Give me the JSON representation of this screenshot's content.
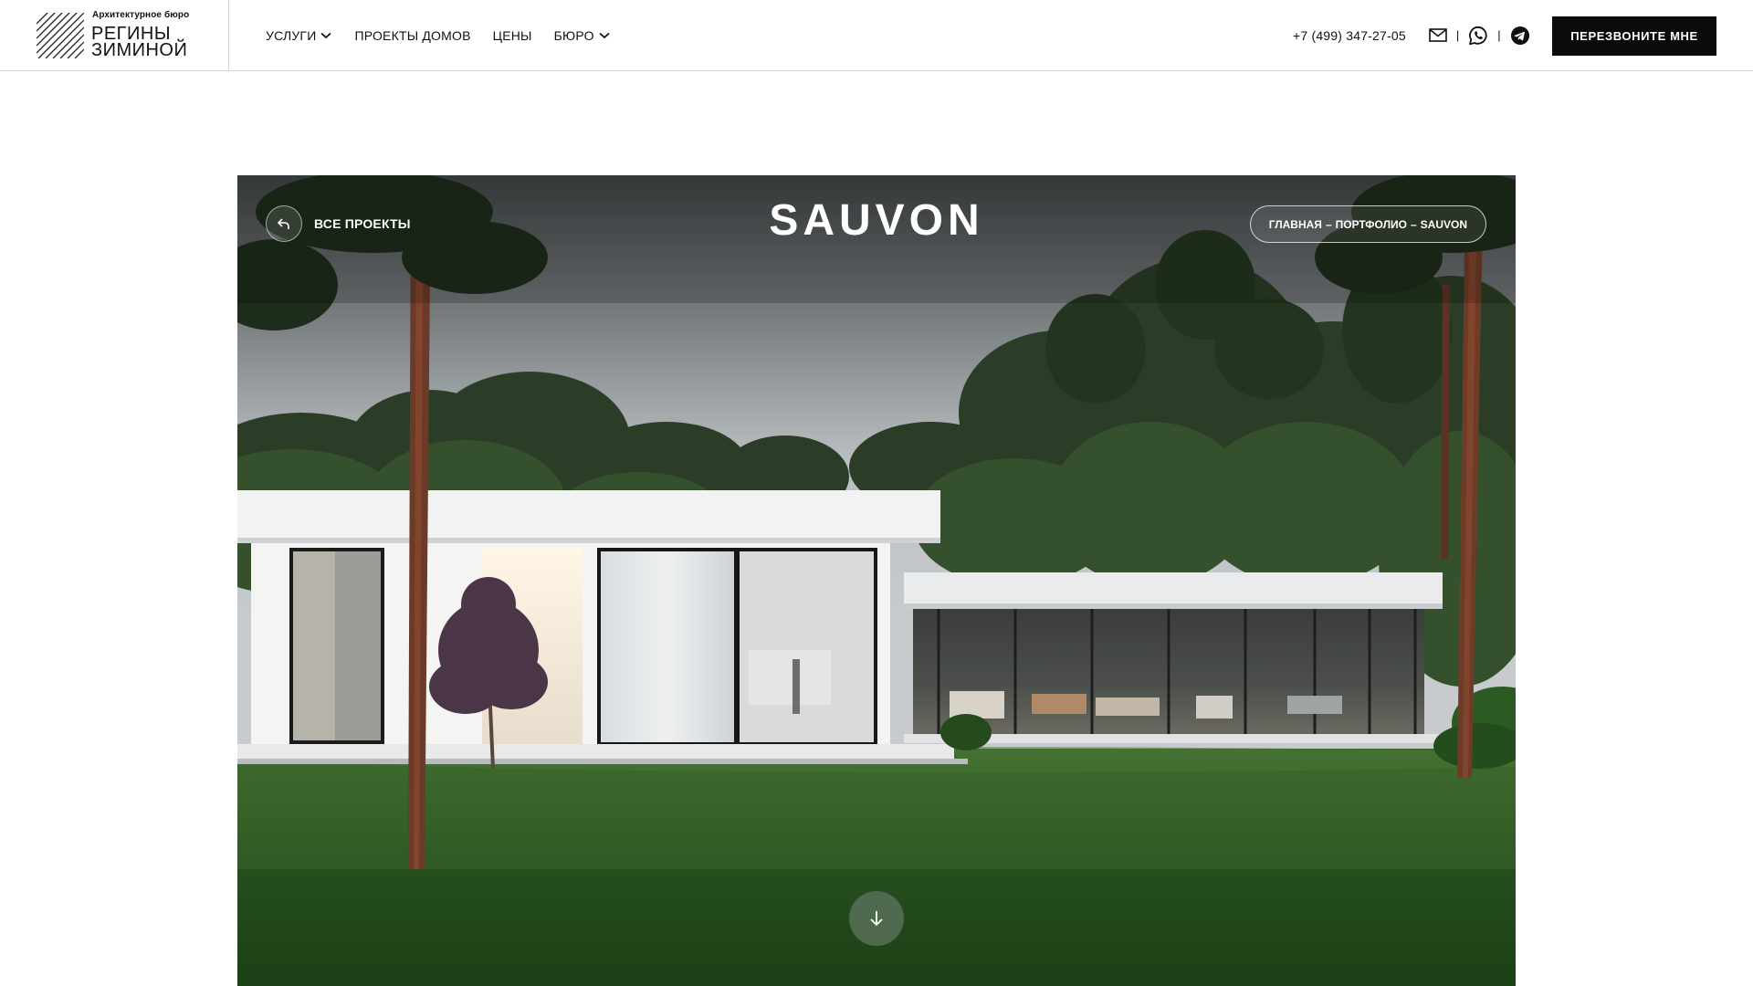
{
  "logo": {
    "subtitle": "Архитектурное бюро",
    "line1": "РЕГИНЫ",
    "line2": "ЗИМИНОЙ"
  },
  "nav": {
    "items": [
      {
        "label": "УСЛУГИ",
        "has_dropdown": true
      },
      {
        "label": "ПРОЕКТЫ ДОМОВ",
        "has_dropdown": false
      },
      {
        "label": "ЦЕНЫ",
        "has_dropdown": false
      },
      {
        "label": "БЮРО",
        "has_dropdown": true
      }
    ]
  },
  "contacts": {
    "phone": "+7 (499) 347-27-05",
    "separator": "|",
    "icons": [
      "mail-icon",
      "whatsapp-icon",
      "telegram-icon"
    ]
  },
  "cta": {
    "label": "ПЕРЕЗВОНИТЕ МНЕ"
  },
  "hero": {
    "title": "SAUVON",
    "back_label": "ВСЕ ПРОЕКТЫ",
    "breadcrumb": {
      "home": "ГЛАВНАЯ",
      "portfolio": "ПОРТФОЛИО",
      "current": "SAUVON",
      "separator": "–"
    },
    "scroll_icon": "arrow-down-icon"
  },
  "colors": {
    "header_bg": "#ffffff",
    "cta_bg": "#0b0b0b",
    "cta_text": "#ffffff",
    "scroll_button": "#556e55"
  }
}
